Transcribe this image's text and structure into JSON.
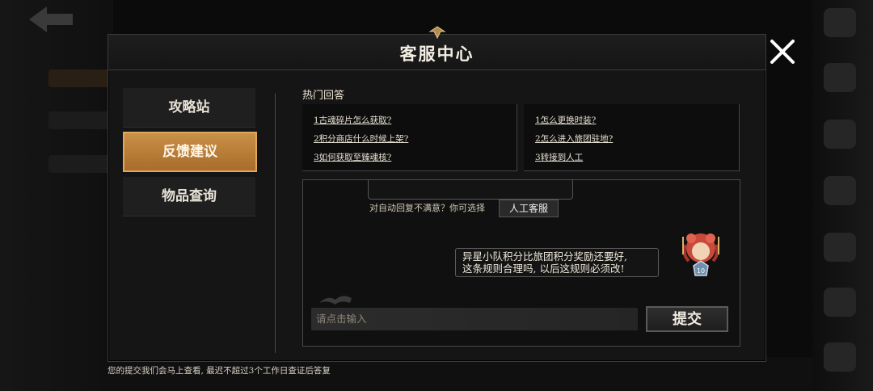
{
  "dialog": {
    "title": "客服中心"
  },
  "menu": {
    "items": [
      {
        "label": "攻略站"
      },
      {
        "label": "反馈建议"
      },
      {
        "label": "物品查询"
      }
    ]
  },
  "faq": {
    "title": "热门回答",
    "left": [
      "1古魂碎片怎么获取?",
      "2积分商店什么时候上架?",
      "3如何获取至臻魂核?"
    ],
    "right": [
      "1怎么更换时装?",
      "2怎么进入旅团驻地?",
      "3转接到人工"
    ]
  },
  "chat": {
    "auto_reply_text": "对自动回复不满意？你可选择",
    "human_service_label": "人工客服",
    "user_message_line1": "异星小队积分比旅团积分奖励还要好,",
    "user_message_line2": "这条规则合理吗, 以后这规则必须改!",
    "avatar_level": "10",
    "input_placeholder": "请点击输入",
    "submit_label": "提交"
  },
  "footer": {
    "notice": "您的提交我们会马上查看, 最迟不超过3个工作日查证后答复"
  },
  "colors": {
    "accent": "#c99047",
    "panel": "#151515"
  }
}
